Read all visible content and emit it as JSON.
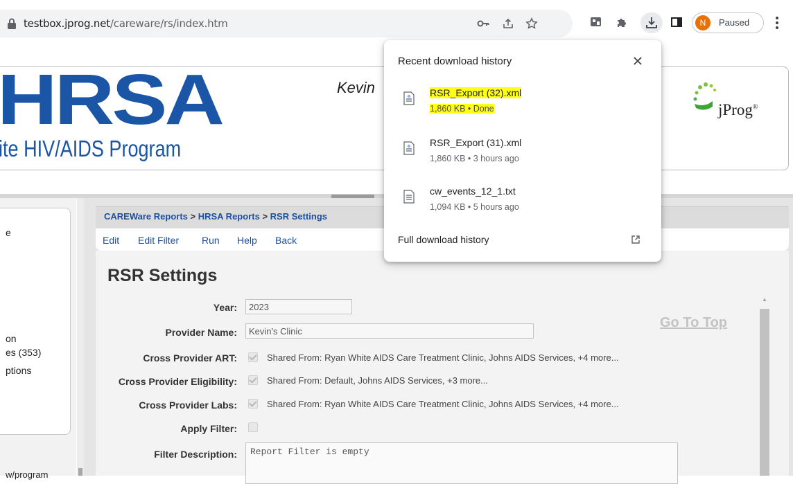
{
  "browser": {
    "url_host": "testbox.jprog.net",
    "url_path": "/careware/rs/index.htm",
    "profile_initial": "N",
    "profile_status": "Paused"
  },
  "download_popup": {
    "title": "Recent download history",
    "items": [
      {
        "name": "RSR_Export (32).xml",
        "meta": "1,860 KB • Done",
        "highlighted": true
      },
      {
        "name": "RSR_Export (31).xml",
        "meta": "1,860 KB • 3 hours ago",
        "highlighted": false
      },
      {
        "name": "cw_events_12_1.txt",
        "meta": "1,094 KB • 5 hours ago",
        "highlighted": false
      }
    ],
    "footer_link": "Full download history"
  },
  "header": {
    "logo_text": "HRSA",
    "program_text": "ite HIV/AIDS Program",
    "user_text": "Kevin",
    "jprog_text": "jProg"
  },
  "sidebar": {
    "lines": [
      "e",
      "on",
      "es (353)",
      "ptions",
      "w/program"
    ]
  },
  "breadcrumb": {
    "items": [
      "CAREWare Reports",
      "HRSA Reports",
      "RSR Settings"
    ],
    "separator": ">"
  },
  "menu": {
    "items": [
      "Edit",
      "Edit Filter",
      "Run",
      "Help",
      "Back"
    ]
  },
  "form": {
    "title": "RSR Settings",
    "goto_top": "Go To Top",
    "year_label": "Year:",
    "year_value": "2023",
    "provider_label": "Provider Name:",
    "provider_value": "Kevin's Clinic",
    "art_label": "Cross Provider ART:",
    "art_value": "Shared From: Ryan White AIDS Care Treatment Clinic, Johns AIDS Services, +4 more...",
    "elig_label": "Cross Provider Eligibility:",
    "elig_value": "Shared From: Default, Johns AIDS Services, +3 more...",
    "labs_label": "Cross Provider Labs:",
    "labs_value": "Shared From: Ryan White AIDS Care Treatment Clinic, Johns AIDS Services, +4 more...",
    "filter_label": "Apply Filter:",
    "desc_label": "Filter Description:",
    "desc_value": "Report Filter is empty"
  },
  "colors": {
    "hrsa_blue": "#1b56a6",
    "highlight": "#ffff1a",
    "avatar": "#e8710a"
  }
}
